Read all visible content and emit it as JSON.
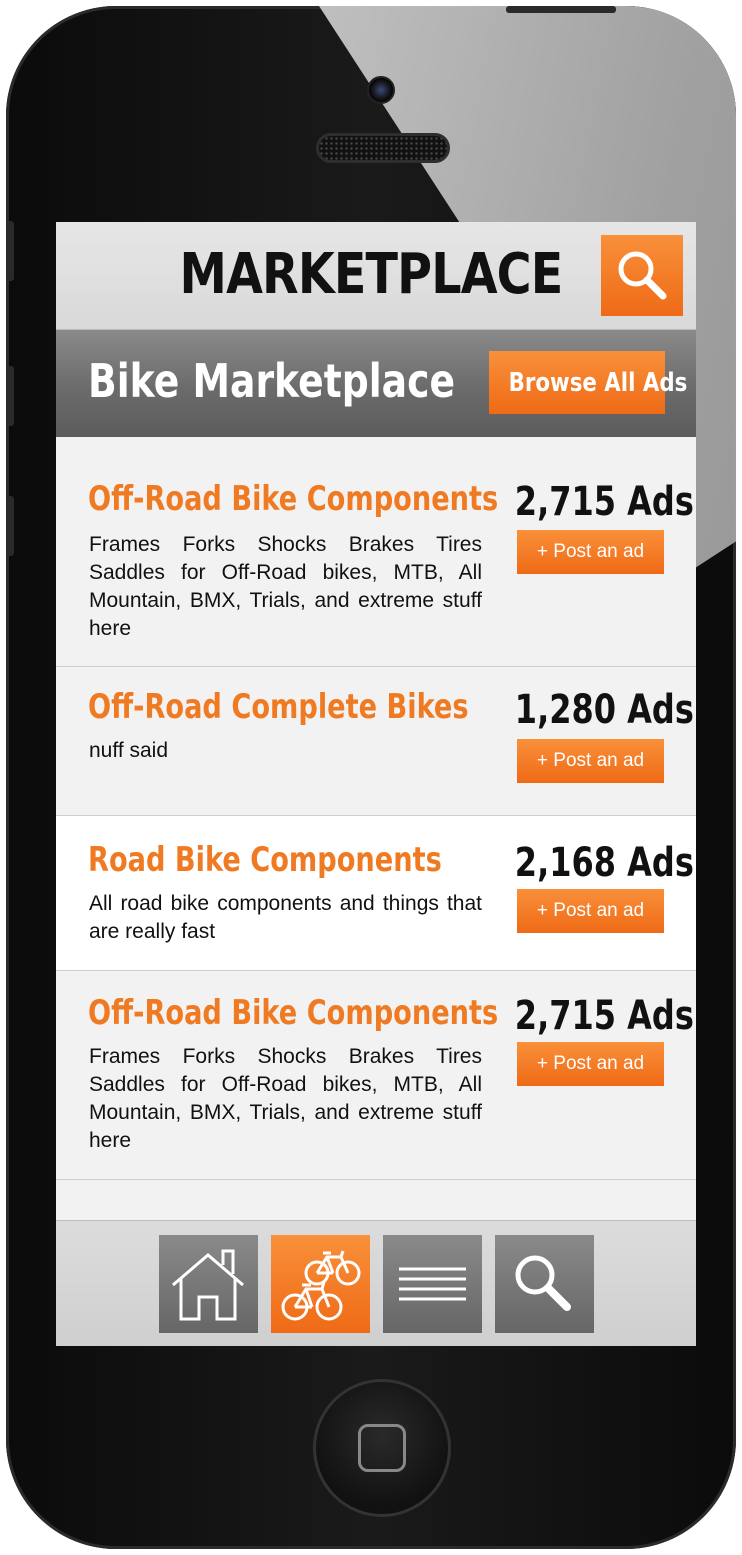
{
  "header": {
    "title": "MARKETPLACE",
    "search_icon": "search-icon"
  },
  "subheader": {
    "title": "Bike Marketplace",
    "browse_label": "Browse All Ads"
  },
  "categories": [
    {
      "name": "Off-Road Bike Components",
      "description": "Frames Forks Shocks Brakes Tires Saddles for Off-Road bikes, MTB, All Mountain, BMX, Trials, and extreme stuff here",
      "count": "2,715 Ads",
      "post_label": "+ Post an ad"
    },
    {
      "name": "Off-Road Complete Bikes",
      "description": "nuff said",
      "count": "1,280 Ads",
      "post_label": "+ Post an ad"
    },
    {
      "name": "Road Bike Components",
      "description": "All road bike components and things that are really fast",
      "count": "2,168 Ads",
      "post_label": "+ Post an ad"
    },
    {
      "name": "Off-Road Bike Components",
      "description": "Frames Forks Shocks Brakes Tires Saddles for Off-Road bikes, MTB, All Mountain, BMX, Trials, and extreme stuff here",
      "count": "2,715 Ads",
      "post_label": "+ Post an ad"
    }
  ],
  "bottom_nav": {
    "items": [
      {
        "icon": "home-icon",
        "active": false
      },
      {
        "icon": "bikes-icon",
        "active": true
      },
      {
        "icon": "menu-lines-icon",
        "active": false
      },
      {
        "icon": "search-icon",
        "active": false
      }
    ]
  },
  "colors": {
    "accent": "#f07a22",
    "accent_dark": "#ef6a16",
    "header_bg": "#e0e0e0",
    "subheader_bg": "#6b6b6b",
    "nav_inactive": "#777777"
  }
}
